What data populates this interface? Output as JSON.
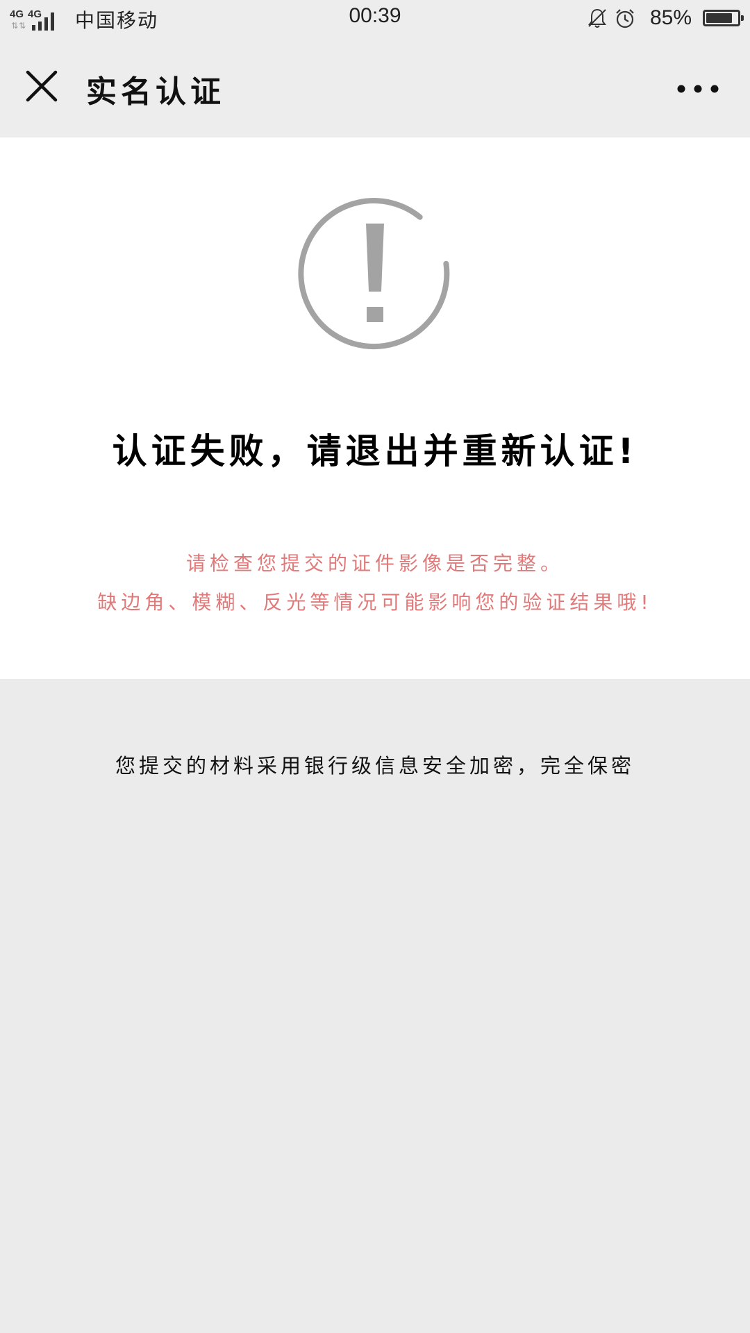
{
  "status_bar": {
    "network_1": "4G",
    "network_2": "4G",
    "carrier": "中国移动",
    "time": "00:39",
    "battery": "85%",
    "battery_level": 0.85,
    "icons": [
      "signal-icon",
      "bell-muted-icon",
      "alarm-icon",
      "battery-icon"
    ]
  },
  "nav": {
    "title": "实名认证",
    "close_icon": "close-icon",
    "more_icon": "more-icon"
  },
  "result": {
    "icon": "warning-icon",
    "title": "认证失败，请退出并重新认证!",
    "hint_line_1": "请检查您提交的证件影像是否完整。",
    "hint_line_2": "缺边角、模糊、反光等情况可能影响您的验证结果哦!"
  },
  "footer": {
    "security_note": "您提交的材料采用银行级信息安全加密，完全保密"
  },
  "colors": {
    "background": "#ebebeb",
    "card": "#ffffff",
    "hint_text": "#e07a7a",
    "icon_gray": "#a3a3a3"
  }
}
